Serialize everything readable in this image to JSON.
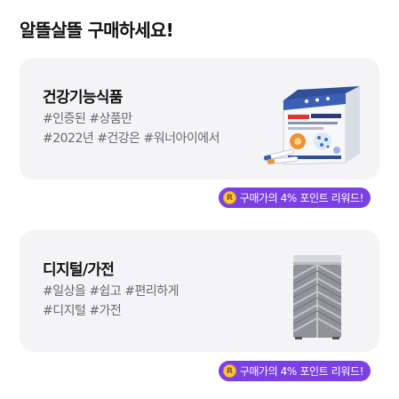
{
  "header": {
    "title": "알뜰살뜰 구매하세요!"
  },
  "cards": [
    {
      "title": "건강기능식품",
      "tags": [
        "#인증된 #상품만",
        "#2022년 #건강은 #워너아이에서"
      ],
      "image_icon": "supplement-box-icon",
      "reward": {
        "coin_symbol": "R",
        "label": "구매가의 4% 포인트 리워드!"
      }
    },
    {
      "title": "디지털/가전",
      "tags": [
        "#일상을 #쉽고 #편리하게",
        "#디지털 #가전"
      ],
      "image_icon": "air-purifier-icon",
      "reward": {
        "coin_symbol": "R",
        "label": "구매가의 4% 포인트 리워드!"
      }
    }
  ],
  "colors": {
    "card_background": "#f4f4f6",
    "badge_background": "#7b3fe4",
    "coin": "#f6c343",
    "tag_text": "#6a6a6e"
  }
}
